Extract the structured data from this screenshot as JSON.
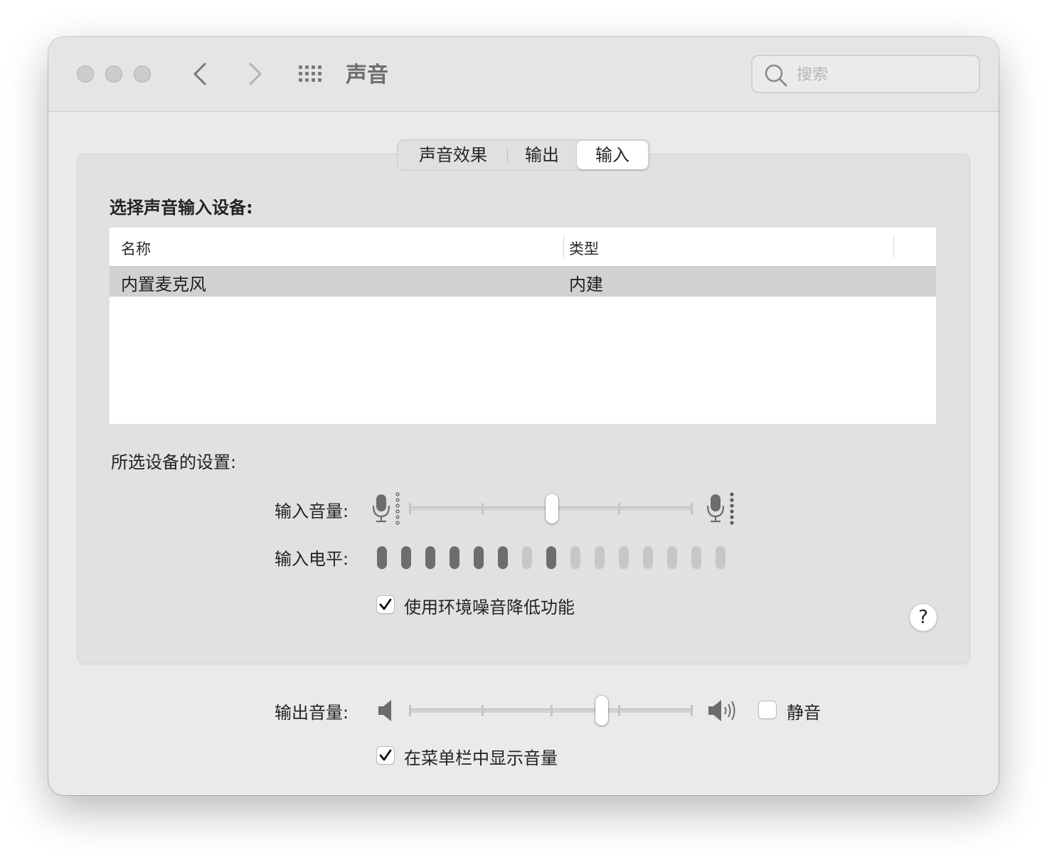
{
  "window": {
    "title": "声音",
    "search_placeholder": "搜索"
  },
  "tabs": [
    {
      "label": "声音效果",
      "active": false
    },
    {
      "label": "输出",
      "active": false
    },
    {
      "label": "输入",
      "active": true
    }
  ],
  "input": {
    "device_section_title": "选择声音输入设备:",
    "columns": [
      "名称",
      "类型"
    ],
    "devices": [
      {
        "name": "内置麦克风",
        "type": "内建",
        "selected": true
      }
    ],
    "settings_title": "所选设备的设置:",
    "volume_label": "输入音量:",
    "volume_level": 0.505,
    "level_label": "输入电平:",
    "level_bars": [
      1,
      1,
      1,
      1,
      1,
      1,
      0,
      1,
      0,
      0,
      0,
      0,
      0,
      0,
      0
    ],
    "noise_reduction_label": "使用环境噪音降低功能",
    "noise_reduction_checked": true,
    "help_label": "?"
  },
  "output": {
    "volume_label": "输出音量:",
    "volume_level": 0.68,
    "mute_label": "静音",
    "mute_checked": false,
    "menubar_label": "在菜单栏中显示音量",
    "menubar_checked": true
  },
  "colors": {
    "window_bg": "#ece9e9",
    "panel_bg": "#e3e0e0",
    "selected_row": "#d2d0d0",
    "meter_active": "#6e6c6c",
    "meter_inactive": "#c9c6c6"
  },
  "icons": [
    "back-chevron-icon",
    "forward-chevron-icon",
    "grid-icon",
    "search-icon",
    "microphone-icon",
    "speaker-icon",
    "checkmark-icon"
  ]
}
